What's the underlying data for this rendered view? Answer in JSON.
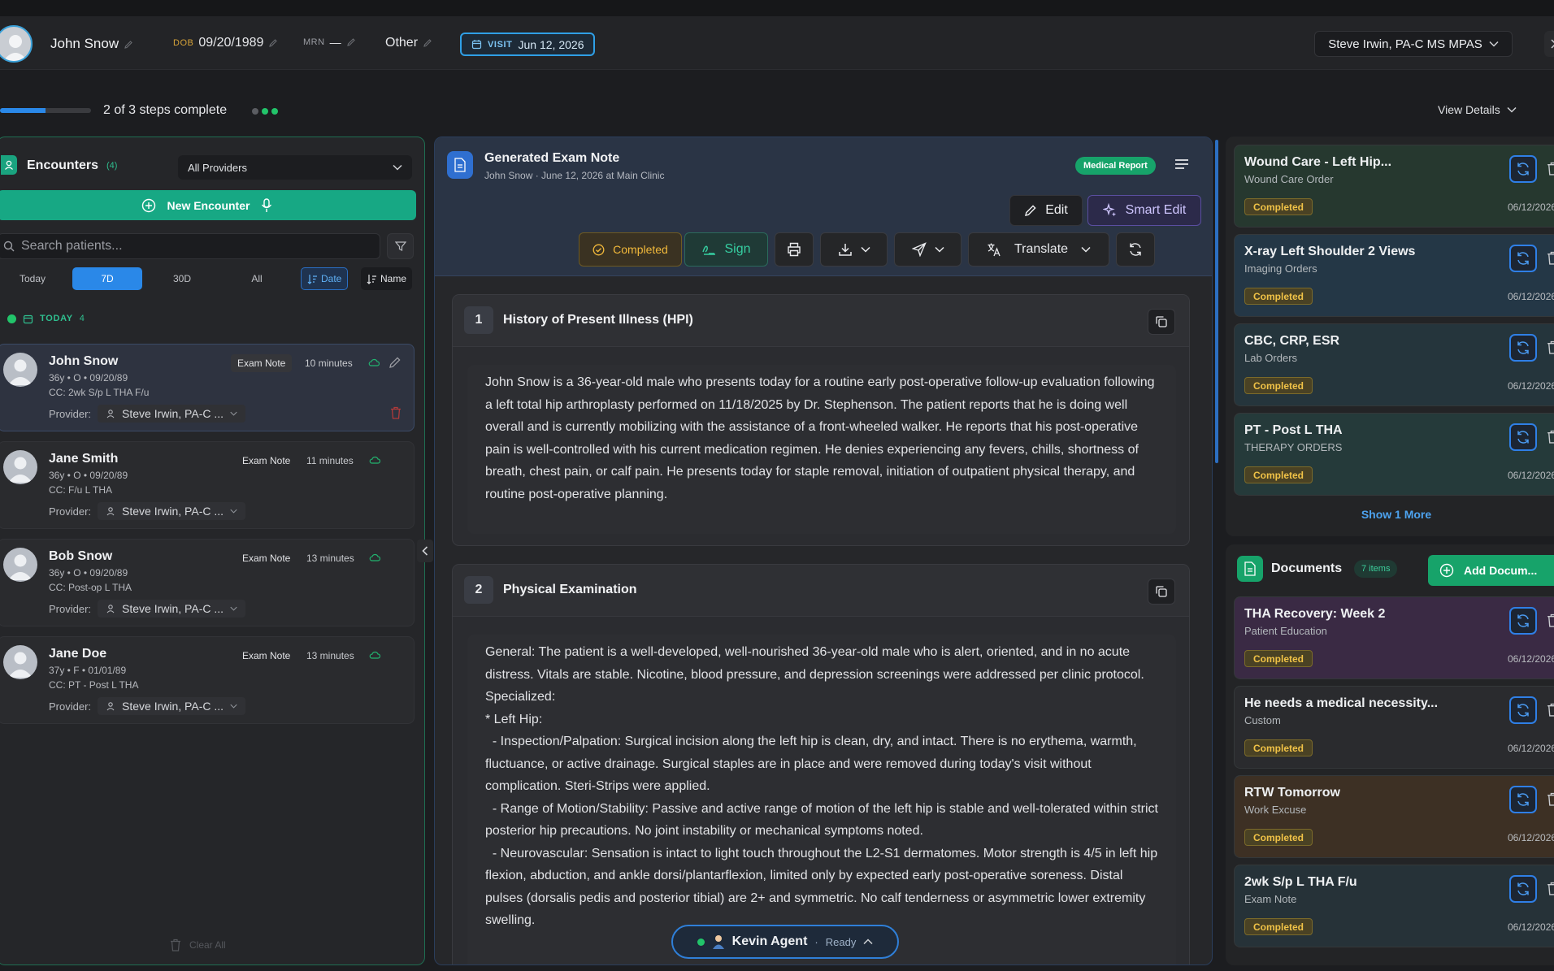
{
  "header": {
    "patient_name": "John Snow",
    "dob_label": "DOB",
    "dob_value": "09/20/1989",
    "mrn_label": "MRN",
    "mrn_value": "—",
    "gender": "Other",
    "visit_label": "VISIT",
    "visit_date": "Jun 12, 2026",
    "provider": "Steve Irwin, PA-C MS MPAS"
  },
  "progress": {
    "text": "2 of 3 steps complete",
    "fraction": 0.5,
    "view_details": "View Details"
  },
  "encounters": {
    "title": "Encounters",
    "count": "(4)",
    "provider_filter": "All Providers",
    "new_encounter": "New Encounter",
    "search_placeholder": "Search patients...",
    "ranges": [
      "Today",
      "7D",
      "30D",
      "All"
    ],
    "active_range": "7D",
    "sort_date": "Date",
    "sort_name": "Name",
    "group_label": "TODAY",
    "group_count": "4",
    "provider_label": "Provider:",
    "clear_all": "Clear All",
    "items": [
      {
        "name": "John Snow",
        "meta": "36y • O • 09/20/89",
        "cc": "CC: 2wk S/p L THA F/u",
        "type": "Exam Note",
        "time": "10 minutes",
        "provider": "Steve Irwin, PA-C ..."
      },
      {
        "name": "Jane Smith",
        "meta": "36y • O • 09/20/89",
        "cc": "CC: F/u L THA",
        "type": "Exam Note",
        "time": "11 minutes",
        "provider": "Steve Irwin, PA-C ..."
      },
      {
        "name": "Bob Snow",
        "meta": "36y • O • 09/20/89",
        "cc": "CC: Post-op L THA",
        "type": "Exam Note",
        "time": "13 minutes",
        "provider": "Steve Irwin, PA-C ..."
      },
      {
        "name": "Jane Doe",
        "meta": "37y • F • 01/01/89",
        "cc": "CC: PT - Post L THA",
        "type": "Exam Note",
        "time": "13 minutes",
        "provider": "Steve Irwin, PA-C ..."
      }
    ]
  },
  "note": {
    "title": "Generated Exam Note",
    "subtitle": "John Snow · June 12, 2026 at Main Clinic",
    "badge": "Medical Report",
    "edit": "Edit",
    "smart_edit": "Smart Edit",
    "status": "Completed",
    "sign": "Sign",
    "translate": "Translate",
    "sections": [
      {
        "num": "1",
        "title": "History of Present Illness (HPI)",
        "body": "John Snow is a 36-year-old male who presents today for a routine early post-operative follow-up evaluation following a left total hip arthroplasty performed on 11/18/2025 by Dr. Stephenson. The patient reports that he is doing well overall and is currently mobilizing with the assistance of a front-wheeled walker. He reports that his post-operative pain is well-controlled with his current medication regimen. He denies experiencing any fevers, chills, shortness of breath, chest pain, or calf pain. He presents today for staple removal, initiation of outpatient physical therapy, and routine post-operative planning."
      },
      {
        "num": "2",
        "title": "Physical Examination",
        "body": "General: The patient is a well-developed, well-nourished 36-year-old male who is alert, oriented, and in no acute distress. Vitals are stable. Nicotine, blood pressure, and depression screenings were addressed per clinic protocol.\nSpecialized:\n* Left Hip:\n  - Inspection/Palpation: Surgical incision along the left hip is clean, dry, and intact. There is no erythema, warmth, fluctuance, or active drainage. Surgical staples are in place and were removed during today's visit without complication. Steri-Strips were applied.\n  - Range of Motion/Stability: Passive and active range of motion of the left hip is stable and well-tolerated within strict posterior hip precautions. No joint instability or mechanical symptoms noted.\n  - Neurovascular: Sensation is intact to light touch throughout the L2-S1 dermatomes. Motor strength is 4/5 in left hip flexion, abduction, and ankle dorsi/plantarflexion, limited only by expected early post-operative soreness. Distal pulses (dorsalis pedis and posterior tibial) are 2+ and symmetric. No calf tenderness or asymmetric lower extremity swelling."
      }
    ]
  },
  "agent": {
    "name": "Kevin Agent",
    "status": "Ready"
  },
  "orders": {
    "show_more": "Show 1 More",
    "items": [
      {
        "title": "Wound Care - Left Hip...",
        "sub": "Wound Care Order",
        "status": "Completed",
        "date": "06/12/2026"
      },
      {
        "title": "X-ray Left Shoulder 2 Views",
        "sub": "Imaging Orders",
        "status": "Completed",
        "date": "06/12/2026"
      },
      {
        "title": "CBC, CRP, ESR",
        "sub": "Lab Orders",
        "status": "Completed",
        "date": "06/12/2026"
      },
      {
        "title": "PT - Post L THA",
        "sub": "THERAPY ORDERS",
        "status": "Completed",
        "date": "06/12/2026"
      }
    ]
  },
  "documents": {
    "title": "Documents",
    "count": "7 items",
    "add": "Add Docum...",
    "items": [
      {
        "title": "THA Recovery: Week 2",
        "sub": "Patient Education",
        "status": "Completed",
        "date": "06/12/2026"
      },
      {
        "title": "He needs a medical necessity...",
        "sub": "Custom",
        "status": "Completed",
        "date": "06/12/2026"
      },
      {
        "title": "RTW Tomorrow",
        "sub": "Work Excuse",
        "status": "Completed",
        "date": "06/12/2026"
      },
      {
        "title": "2wk S/p L THA F/u",
        "sub": "Exam Note",
        "status": "Completed",
        "date": "06/12/2026"
      }
    ]
  },
  "colors": {
    "accent_blue": "#2a88e8",
    "accent_green": "#17a884",
    "status_amber": "#f0c247"
  }
}
